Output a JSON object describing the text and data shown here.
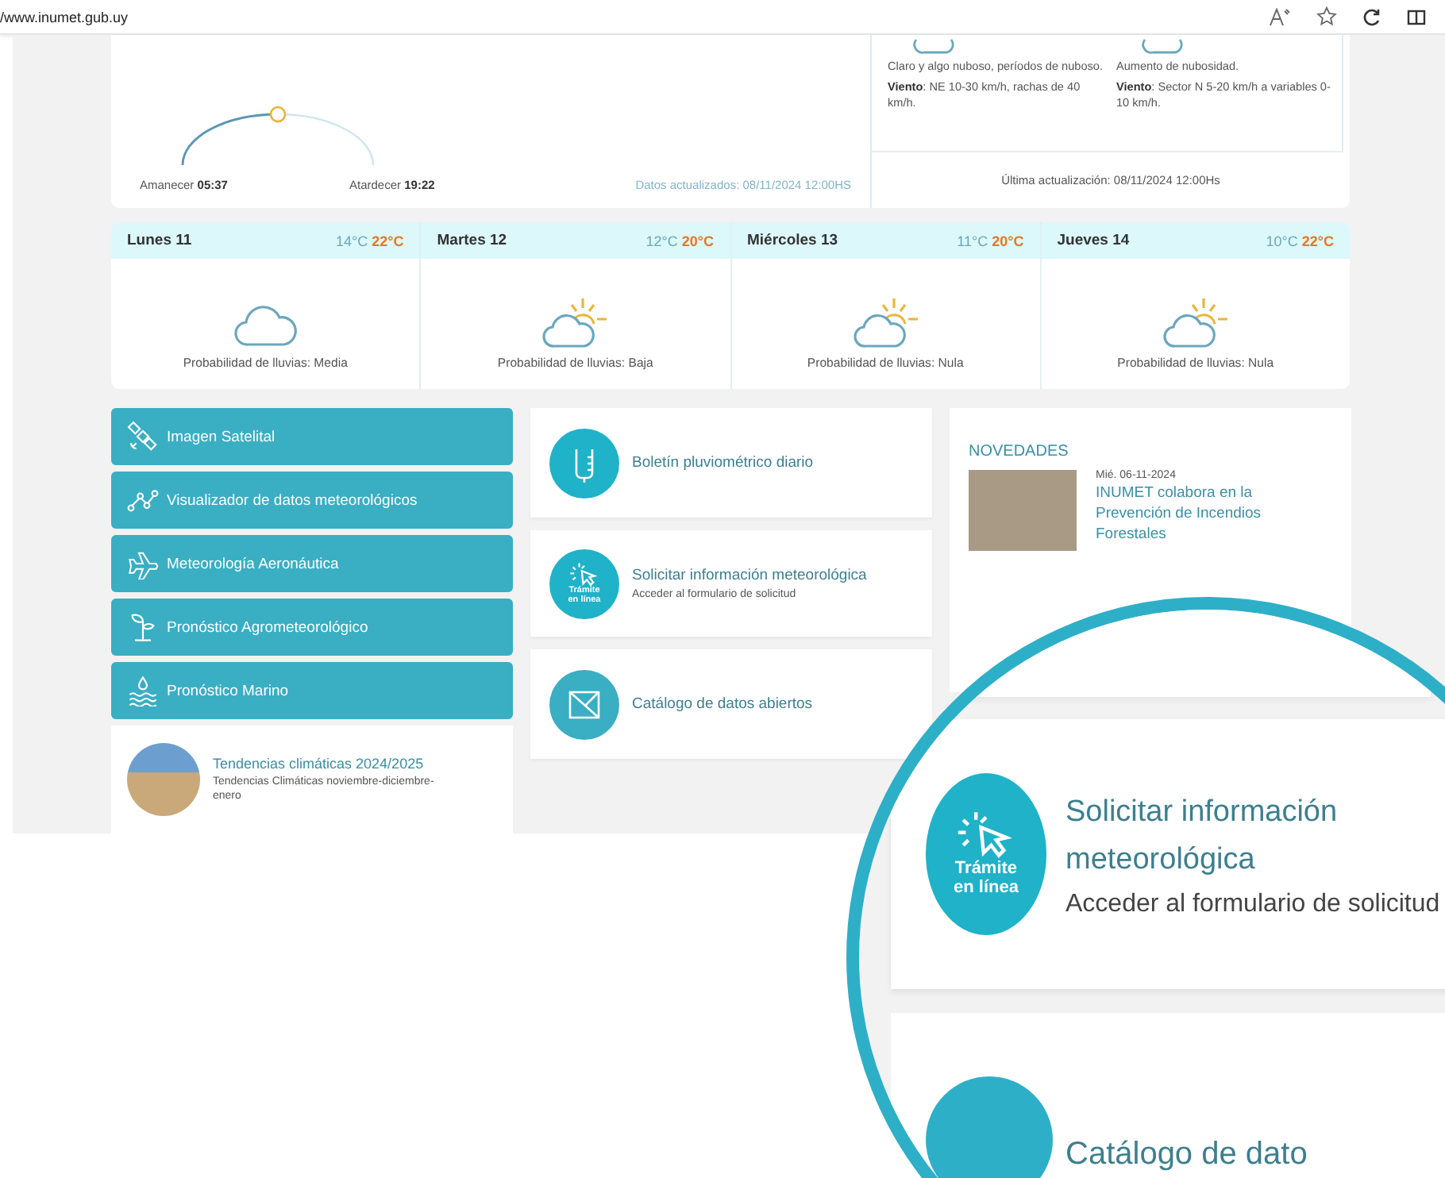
{
  "browser": {
    "url": "/www.inumet.gub.uy"
  },
  "sun": {
    "sunrise_label": "Amanecer",
    "sunrise": "05:37",
    "sunset_label": "Atardecer",
    "sunset": "19:22",
    "level": 0.5
  },
  "updated": "Datos actualizados: 08/11/2024 12:00HS",
  "forecast_columns": [
    {
      "text": "Claro y algo nuboso, períodos de nuboso.",
      "wind": "**Viento**: NE 10-30 km/h, rachas de 40 km/h."
    },
    {
      "text": "Aumento de nubosidad.",
      "wind": "**Viento**: Sector N 5-20 km/h a variables 0-10 km/h."
    }
  ],
  "last_update": "Última actualización: 08/11/2024 12:00Hs",
  "days": [
    {
      "name": "Lunes 11",
      "min": "14°C",
      "max": "22°C",
      "kind": "cloud",
      "rain": "Probabilidad de lluvias: Media"
    },
    {
      "name": "Martes 12",
      "min": "12°C",
      "max": "20°C",
      "kind": "partly",
      "rain": "Probabilidad de lluvias: Baja"
    },
    {
      "name": "Miércoles 13",
      "min": "11°C",
      "max": "20°C",
      "kind": "partly",
      "rain": "Probabilidad de lluvias: Nula"
    },
    {
      "name": "Jueves 14",
      "min": "10°C",
      "max": "22°C",
      "kind": "partly",
      "rain": "Probabilidad de lluvias: Nula"
    }
  ],
  "quick_links": [
    {
      "kind": "satellite",
      "label": "Imagen Satelital"
    },
    {
      "kind": "chart",
      "label": "Visualizador de datos meteorológicos"
    },
    {
      "kind": "plane",
      "label": "Meteorología Aeronáutica"
    },
    {
      "kind": "sprout",
      "label": "Pronóstico Agrometeorológico"
    },
    {
      "kind": "marine",
      "label": "Pronóstico Marino"
    }
  ],
  "feature": {
    "title": "Tendencias climáticas 2024/2025",
    "subtitle": "Tendencias Climáticas noviembre-diciembre-enero"
  },
  "services": [
    {
      "kind": "gauge",
      "title": "Boletín pluviométrico diario"
    },
    {
      "kind": "online",
      "title": "Solicitar información meteorológica",
      "subtitle": "Acceder al formulario de solicitud",
      "badge": "Trámite en línea"
    },
    {
      "kind": "mail",
      "title": "Catálogo de datos abiertos"
    }
  ],
  "news": {
    "heading": "NOVEDADES",
    "items": [
      {
        "date": "Mié. 06-11-2024",
        "title": "INUMET colabora en la Prevención de Incendios Forestales"
      }
    ]
  },
  "magnifier": {
    "badge": "Trámite en línea",
    "title": "Solicitar información meteorológica",
    "subtitle": "Acceder al formulario de solicitud",
    "next_title": "Catálogo de dato"
  }
}
